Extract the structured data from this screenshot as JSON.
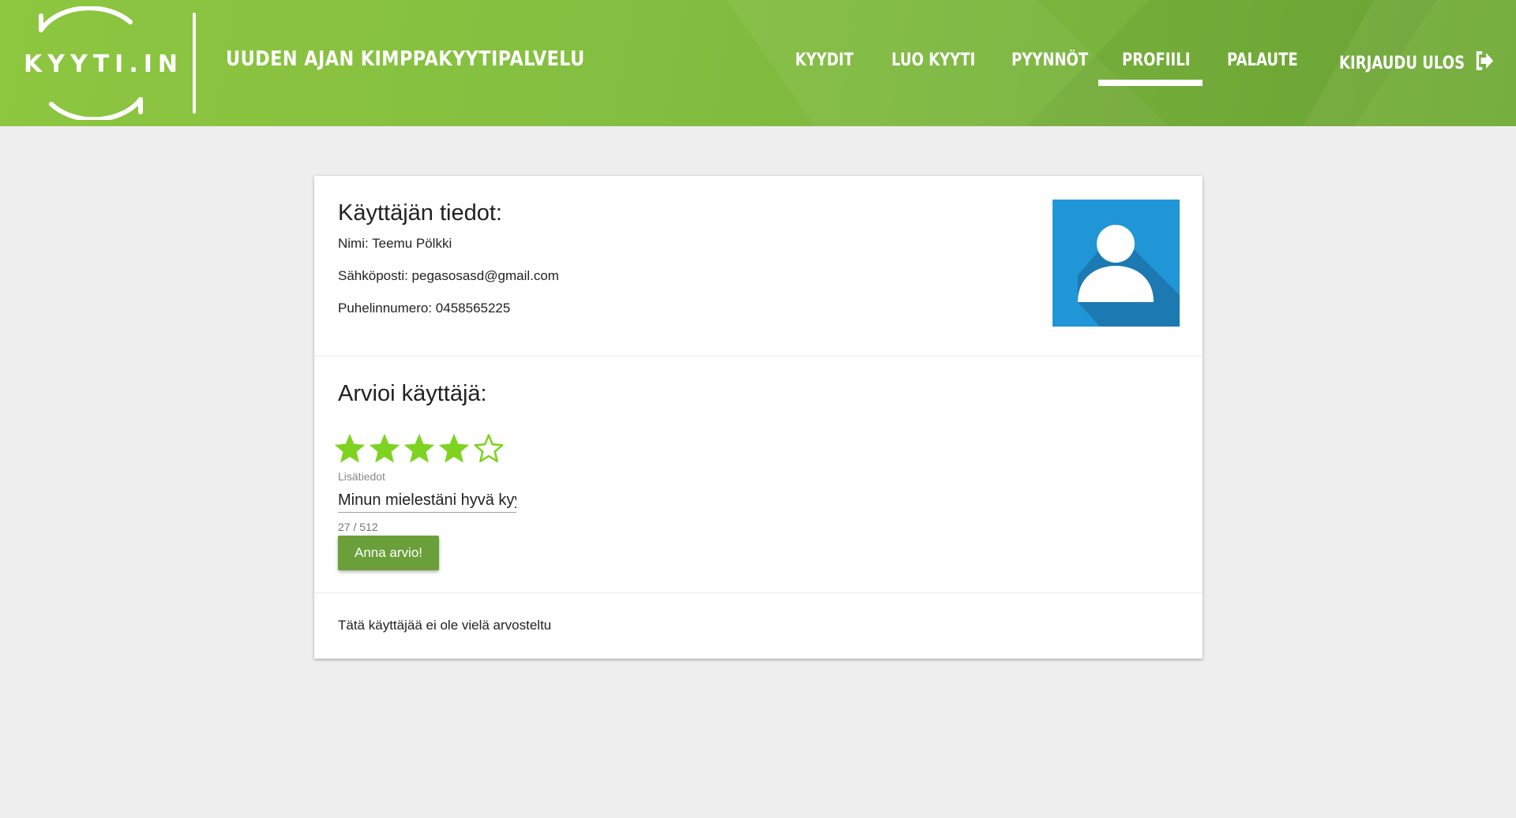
{
  "header": {
    "logo_text": "KYYTI.IN",
    "tagline": "UUDEN AJAN KIMPPAKYYTIPALVELU",
    "nav": [
      {
        "label": "KYYDIT",
        "active": false
      },
      {
        "label": "LUO KYYTI",
        "active": false
      },
      {
        "label": "PYYNNÖT",
        "active": false
      },
      {
        "label": "PROFIILI",
        "active": true
      },
      {
        "label": "PALAUTE",
        "active": false
      },
      {
        "label": "KIRJAUDU ULOS",
        "active": false,
        "icon": "logout-icon"
      }
    ]
  },
  "profile": {
    "title": "Käyttäjän tiedot:",
    "name": "Nimi: Teemu Pölkki",
    "email": "Sähköposti: pegasosasd@gmail.com",
    "phone": "Puhelinnumero: 0458565225",
    "avatar_icon": "user-avatar-icon"
  },
  "rating": {
    "title": "Arvioi käyttäjä:",
    "stars_selected": 4,
    "stars_total": 5,
    "field_label": "Lisätiedot",
    "field_value": "Minun mielestäni hyvä kyyti",
    "counter": "27 / 512",
    "submit_label": "Anna arvio!"
  },
  "reviews": {
    "empty_text": "Tätä käyttäjää ei ole vielä arvosteltu"
  },
  "colors": {
    "header_green": "#84bf41",
    "star_green": "#7ed321",
    "button_green": "#6a9f3a",
    "avatar_blue": "#2196d6"
  }
}
